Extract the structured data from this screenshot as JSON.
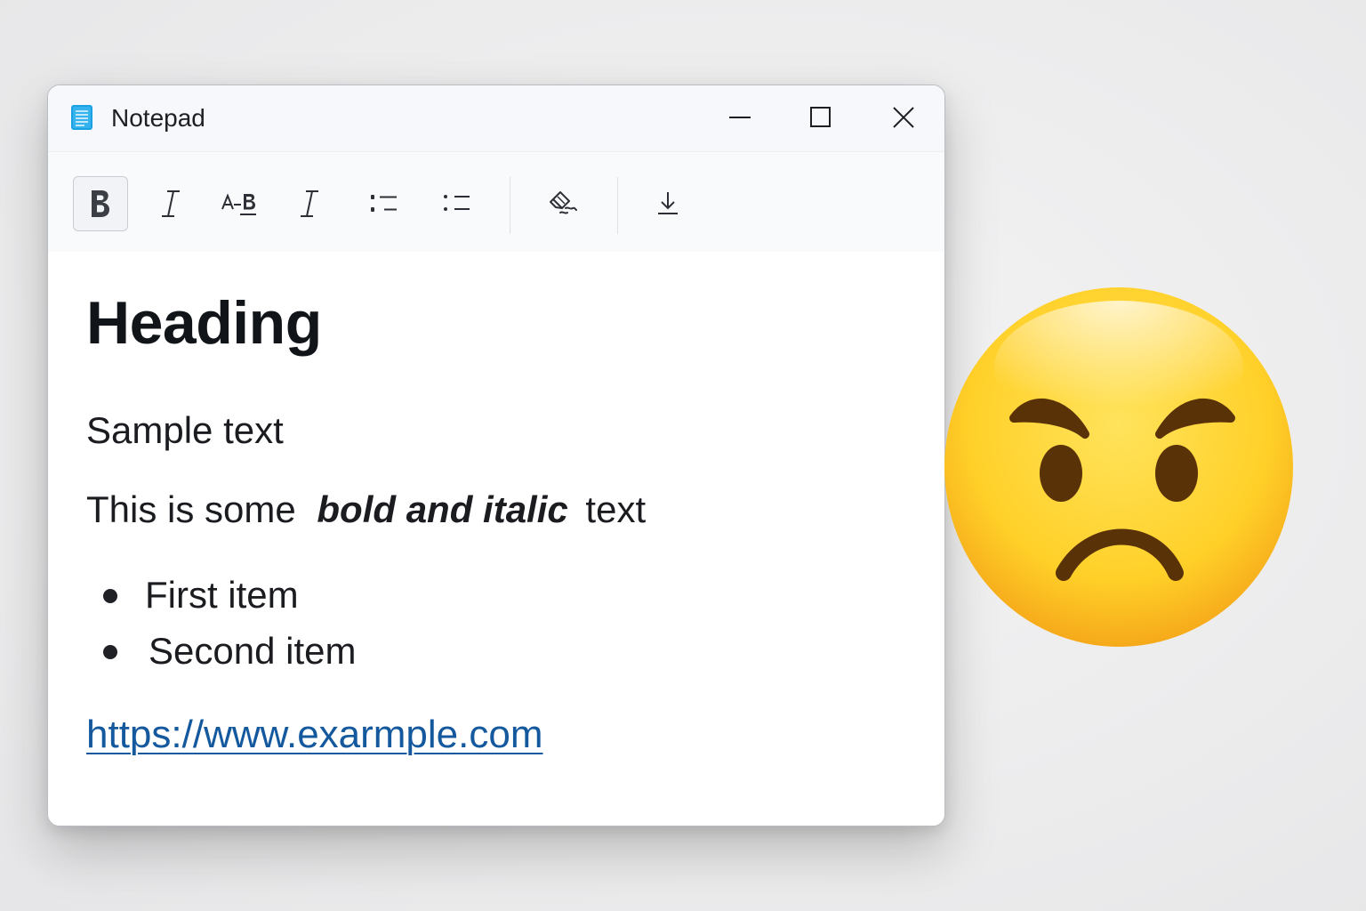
{
  "window": {
    "title": "Notepad",
    "controls": [
      "minimize-icon",
      "maximize-icon",
      "close-icon"
    ]
  },
  "toolbar": {
    "buttons": [
      {
        "name": "bold",
        "icon": "bold-icon",
        "active": true
      },
      {
        "name": "italic",
        "icon": "italic-icon",
        "active": false
      },
      {
        "name": "strikethrough",
        "icon": "strikethrough-icon",
        "active": false
      },
      {
        "name": "italic-alt",
        "icon": "italic-icon",
        "active": false
      },
      {
        "name": "bulleted-list",
        "icon": "bulleted-list-icon",
        "active": false
      },
      {
        "name": "list",
        "icon": "list-icon",
        "active": false
      },
      {
        "name": "clear-formatting",
        "icon": "clear-formatting-icon",
        "active": false
      },
      {
        "name": "download",
        "icon": "download-icon",
        "active": false
      }
    ]
  },
  "document": {
    "heading": "Heading",
    "sample_text": "Sample text",
    "mixed_line": {
      "prefix": "This is some",
      "emphasis": "bold and italic",
      "suffix": "text"
    },
    "list_items": [
      "First item",
      "Second item"
    ],
    "link": "https://www.exarmple.com"
  },
  "decoration": {
    "emoji": "angry-face-emoji"
  },
  "colors": {
    "accent_icon": "#1ba1e2",
    "link": "#14589e",
    "text": "#1a1c20",
    "emoji_face": "#ffd23a",
    "emoji_features": "#5a3208"
  }
}
